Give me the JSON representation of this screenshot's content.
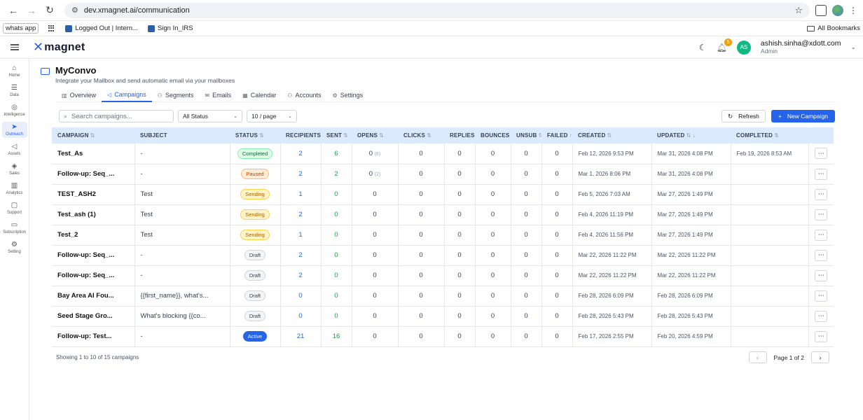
{
  "browser": {
    "url": "dev.xmagnet.ai/communication",
    "bookmarks": [
      {
        "label": "whats app"
      },
      {
        "label": "Logged Out | Intern..."
      },
      {
        "label": "Sign In_IRS"
      }
    ],
    "all_bookmarks": "All Bookmarks"
  },
  "app": {
    "logo_text": "magnet",
    "notification_count": "5",
    "user": {
      "initials": "AS",
      "email": "ashish.sinha@xdott.com",
      "role": "Admin"
    }
  },
  "sidebar": {
    "items": [
      {
        "label": "Home",
        "icon": "home-icon",
        "glyph": "⌂"
      },
      {
        "label": "Data",
        "icon": "database-icon",
        "glyph": "☰"
      },
      {
        "label": "Intelligence",
        "icon": "bulb-icon",
        "glyph": "◎"
      },
      {
        "label": "Outreach",
        "icon": "send-icon",
        "glyph": "➤"
      },
      {
        "label": "Assets",
        "icon": "megaphone-icon",
        "glyph": "◁"
      },
      {
        "label": "Sales",
        "icon": "shield-icon",
        "glyph": "◈"
      },
      {
        "label": "Analytics",
        "icon": "chart-icon",
        "glyph": "▥"
      },
      {
        "label": "Support",
        "icon": "chat-icon",
        "glyph": "▢"
      },
      {
        "label": "Subscription",
        "icon": "card-icon",
        "glyph": "▭"
      },
      {
        "label": "Setting",
        "icon": "gear-icon",
        "glyph": "⚙"
      }
    ],
    "active_index": 3
  },
  "page": {
    "title": "MyConvo",
    "subtitle": "Integrate your Mailbox and send automatic email via your mailboxes"
  },
  "tabs": [
    {
      "label": "Overview",
      "icon": "chart-icon",
      "glyph": "▥"
    },
    {
      "label": "Campaigns",
      "icon": "megaphone-icon",
      "glyph": "◁"
    },
    {
      "label": "Segments",
      "icon": "users-icon",
      "glyph": "⚇"
    },
    {
      "label": "Emails",
      "icon": "mail-icon",
      "glyph": "✉"
    },
    {
      "label": "Calendar",
      "icon": "calendar-icon",
      "glyph": "▦"
    },
    {
      "label": "Accounts",
      "icon": "users-icon",
      "glyph": "⚇"
    },
    {
      "label": "Settings",
      "icon": "gear-icon",
      "glyph": "⚙"
    }
  ],
  "toolbar": {
    "search_placeholder": "Search campaigns...",
    "status_filter": "All Status",
    "page_size": "10 / page",
    "refresh_label": "Refresh",
    "new_label": "New Campaign"
  },
  "table": {
    "columns": [
      {
        "label": "CAMPAIGN",
        "sort": "⇅"
      },
      {
        "label": "SUBJECT",
        "sort": ""
      },
      {
        "label": "STATUS",
        "sort": "⇅"
      },
      {
        "label": "RECIPIENTS",
        "sort": "↑"
      },
      {
        "label": "SENT",
        "sort": "⇅"
      },
      {
        "label": "OPENS",
        "sort": "⇅"
      },
      {
        "label": "CLICKS",
        "sort": "⇅"
      },
      {
        "label": "REPLIES",
        "sort": "↑"
      },
      {
        "label": "BOUNCES",
        "sort": "↑"
      },
      {
        "label": "UNSUB",
        "sort": "⇅"
      },
      {
        "label": "FAILED",
        "sort": "↑"
      },
      {
        "label": "CREATED",
        "sort": "⇅"
      },
      {
        "label": "UPDATED",
        "sort": "⇅ ↓"
      },
      {
        "label": "COMPLETED",
        "sort": "⇅"
      },
      {
        "label": "",
        "sort": ""
      }
    ],
    "rows": [
      {
        "campaign": "Test_As",
        "subject": "-",
        "status": "Completed",
        "status_class": "b-completed",
        "recipients": "2",
        "sent": "6",
        "opens": "0",
        "opens_sub": "(6)",
        "clicks": "0",
        "replies": "0",
        "bounces": "0",
        "unsub": "0",
        "failed": "0",
        "created": "Feb 12, 2026 9:53 PM",
        "updated": "Mar 31, 2026 4:08 PM",
        "completed": "Feb 19, 2026 8:53 AM"
      },
      {
        "campaign": "Follow-up: Seq_...",
        "subject": "-",
        "status": "Paused",
        "status_class": "b-paused",
        "recipients": "2",
        "sent": "2",
        "opens": "0",
        "opens_sub": "(2)",
        "clicks": "0",
        "replies": "0",
        "bounces": "0",
        "unsub": "0",
        "failed": "0",
        "created": "Mar 1, 2026 8:06 PM",
        "updated": "Mar 31, 2026 4:08 PM",
        "completed": ""
      },
      {
        "campaign": "TEST_ASH2",
        "subject": "Test",
        "status": "Sending",
        "status_class": "b-sending",
        "recipients": "1",
        "sent": "0",
        "opens": "0",
        "opens_sub": "",
        "clicks": "0",
        "replies": "0",
        "bounces": "0",
        "unsub": "0",
        "failed": "0",
        "created": "Feb 5, 2026 7:03 AM",
        "updated": "Mar 27, 2026 1:49 PM",
        "completed": ""
      },
      {
        "campaign": "Test_ash (1)",
        "subject": "Test",
        "status": "Sending",
        "status_class": "b-sending",
        "recipients": "2",
        "sent": "0",
        "opens": "0",
        "opens_sub": "",
        "clicks": "0",
        "replies": "0",
        "bounces": "0",
        "unsub": "0",
        "failed": "0",
        "created": "Feb 4, 2026 11:19 PM",
        "updated": "Mar 27, 2026 1:49 PM",
        "completed": ""
      },
      {
        "campaign": "Test_2",
        "subject": "Test",
        "status": "Sending",
        "status_class": "b-sending",
        "recipients": "1",
        "sent": "0",
        "opens": "0",
        "opens_sub": "",
        "clicks": "0",
        "replies": "0",
        "bounces": "0",
        "unsub": "0",
        "failed": "0",
        "created": "Feb 4, 2026 11:56 PM",
        "updated": "Mar 27, 2026 1:49 PM",
        "completed": ""
      },
      {
        "campaign": "Follow-up: Seq_...",
        "subject": "-",
        "status": "Draft",
        "status_class": "b-draft",
        "recipients": "2",
        "sent": "0",
        "opens": "0",
        "opens_sub": "",
        "clicks": "0",
        "replies": "0",
        "bounces": "0",
        "unsub": "0",
        "failed": "0",
        "created": "Mar 22, 2026 11:22 PM",
        "updated": "Mar 22, 2026 11:22 PM",
        "completed": ""
      },
      {
        "campaign": "Follow-up: Seq_...",
        "subject": "-",
        "status": "Draft",
        "status_class": "b-draft",
        "recipients": "2",
        "sent": "0",
        "opens": "0",
        "opens_sub": "",
        "clicks": "0",
        "replies": "0",
        "bounces": "0",
        "unsub": "0",
        "failed": "0",
        "created": "Mar 22, 2026 11:22 PM",
        "updated": "Mar 22, 2026 11:22 PM",
        "completed": ""
      },
      {
        "campaign": "Bay Area AI Fou...",
        "subject": "{{first_name}}, what's...",
        "status": "Draft",
        "status_class": "b-draft",
        "recipients": "0",
        "sent": "0",
        "opens": "0",
        "opens_sub": "",
        "clicks": "0",
        "replies": "0",
        "bounces": "0",
        "unsub": "0",
        "failed": "0",
        "created": "Feb 28, 2026 6:09 PM",
        "updated": "Feb 28, 2026 6:09 PM",
        "completed": ""
      },
      {
        "campaign": "Seed Stage Gro...",
        "subject": "What's blocking {{co...",
        "status": "Draft",
        "status_class": "b-draft",
        "recipients": "0",
        "sent": "0",
        "opens": "0",
        "opens_sub": "",
        "clicks": "0",
        "replies": "0",
        "bounces": "0",
        "unsub": "0",
        "failed": "0",
        "created": "Feb 28, 2026 5:43 PM",
        "updated": "Feb 28, 2026 5:43 PM",
        "completed": ""
      },
      {
        "campaign": "Follow-up: Test...",
        "subject": "-",
        "status": "Active",
        "status_class": "b-active",
        "recipients": "21",
        "sent": "16",
        "opens": "0",
        "opens_sub": "",
        "clicks": "0",
        "replies": "0",
        "bounces": "0",
        "unsub": "0",
        "failed": "0",
        "created": "Feb 17, 2026 2:55 PM",
        "updated": "Feb 20, 2026 4:59 PM",
        "completed": ""
      }
    ]
  },
  "footer": {
    "showing": "Showing 1 to 10 of 15 campaigns",
    "page_text": "Page 1 of 2"
  },
  "colors": {
    "accent": "#2563eb",
    "header_bg": "#dbeafe",
    "green": "#16a34a"
  }
}
